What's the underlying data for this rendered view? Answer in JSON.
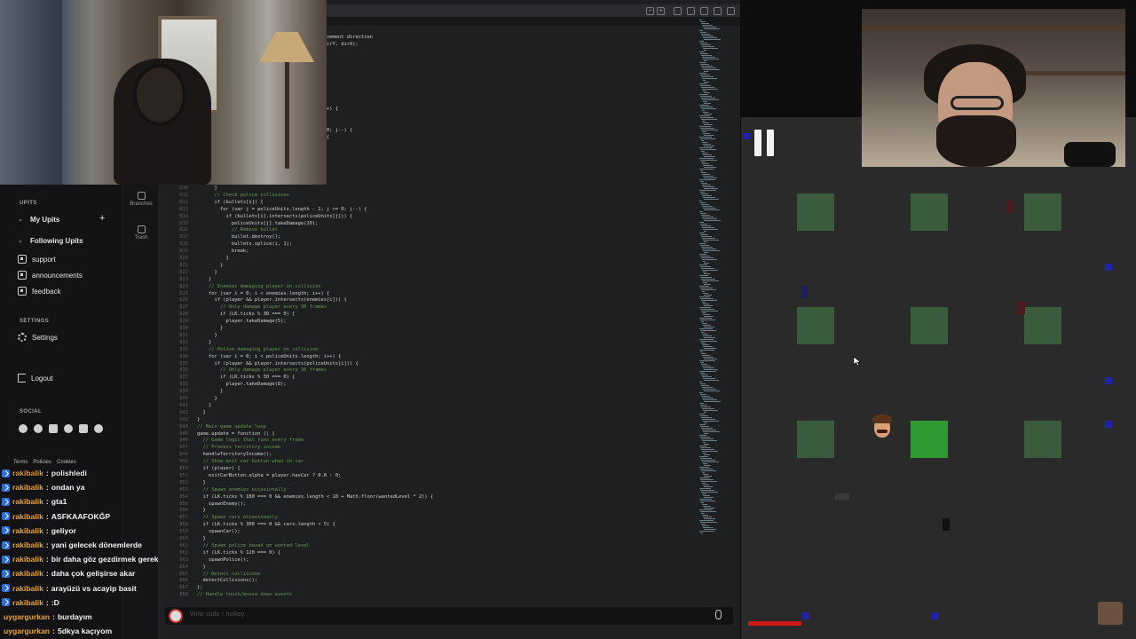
{
  "sidebar": {
    "upits_label": "UPITS",
    "my_upits": "My Upits",
    "following_upits": "Following Upits",
    "items": [
      {
        "label": "support",
        "icon": "box-icon"
      },
      {
        "label": "announcements",
        "icon": "box-icon"
      },
      {
        "label": "feedback",
        "icon": "box-icon"
      }
    ],
    "settings_section": "SETTINGS",
    "settings_label": "Settings",
    "logout_label": "Logout",
    "social_section": "SOCIAL",
    "social_icons": [
      "discord-icon",
      "reddit-icon",
      "x-icon",
      "bluesky-icon",
      "instagram-icon",
      "facebook-icon"
    ],
    "footer_links": [
      "Terms",
      "Policies",
      "Cookies"
    ]
  },
  "rail": {
    "branches_label": "Branches",
    "trash_label": "Trash"
  },
  "chat": {
    "messages": [
      {
        "user": "rakibalik",
        "text": "polishledi"
      },
      {
        "user": "rakibalik",
        "text": "ondan ya"
      },
      {
        "user": "rakibalik",
        "text": "gta1"
      },
      {
        "user": "rakibalik",
        "text": "ASFKAAFOKĞP"
      },
      {
        "user": "rakibalik",
        "text": "geliyor"
      },
      {
        "user": "rakibalik",
        "text": "yani gelecek dönemlerde"
      },
      {
        "user": "rakibalik",
        "text": "bir daha göz gezdirmek gerek"
      },
      {
        "user": "rakibalik",
        "text": "daha çok gelişirse akar"
      },
      {
        "user": "rakibalik",
        "text": "arayüzü vs acayip basit"
      },
      {
        "user": "rakibalik",
        "text": ":D"
      },
      {
        "user": "uygargurkan",
        "text": "burdayım"
      },
      {
        "user": "uygargurkan",
        "text": "5dkya kaçıyom"
      }
    ],
    "separator": ":",
    "user_color": "#e5a43a"
  },
  "editor": {
    "top_fragments": [
      "vement direction",
      "irY, dirX);",
      "+) {",
      "0; j--) {",
      "{"
    ],
    "lines": [
      {
        "n": "810",
        "t": "      }"
      },
      {
        "n": "811",
        "t": "      // Check police collisions"
      },
      {
        "n": "812",
        "t": "      if (bullets[i]) {"
      },
      {
        "n": "813",
        "t": "        for (var j = policeUnits.length - 1; j >= 0; j--) {"
      },
      {
        "n": "814",
        "t": "          if (bullets[i].intersects(policeUnits[j])) {"
      },
      {
        "n": "815",
        "t": "            policeUnits[j].takeDamage(20);"
      },
      {
        "n": "816",
        "t": "            // Remove bullet"
      },
      {
        "n": "817",
        "t": "            bullet.destroy();"
      },
      {
        "n": "818",
        "t": "            bullets.splice(i, 1);"
      },
      {
        "n": "819",
        "t": "            break;"
      },
      {
        "n": "820",
        "t": "          }"
      },
      {
        "n": "821",
        "t": "        }"
      },
      {
        "n": "822",
        "t": "      }"
      },
      {
        "n": "823",
        "t": "    }"
      },
      {
        "n": "824",
        "t": "    // Enemies damaging player on collision"
      },
      {
        "n": "825",
        "t": "    for (var i = 0; i < enemies.length; i++) {"
      },
      {
        "n": "826",
        "t": "      if (player && player.intersects(enemies[i])) {"
      },
      {
        "n": "827",
        "t": "        // Only damage player every 30 frames"
      },
      {
        "n": "828",
        "t": "        if (LK.ticks % 30 === 0) {"
      },
      {
        "n": "829",
        "t": "          player.takeDamage(5);"
      },
      {
        "n": "830",
        "t": "        }"
      },
      {
        "n": "831",
        "t": "      }"
      },
      {
        "n": "832",
        "t": "    }"
      },
      {
        "n": "833",
        "t": "    // Police damaging player on collision"
      },
      {
        "n": "834",
        "t": "    for (var i = 0; i < policeUnits.length; i++) {"
      },
      {
        "n": "835",
        "t": "      if (player && player.intersects(policeUnits[i])) {"
      },
      {
        "n": "836",
        "t": "        // Only damage player every 30 frames"
      },
      {
        "n": "837",
        "t": "        if (LK.ticks % 30 === 0) {"
      },
      {
        "n": "838",
        "t": "          player.takeDamage(8);"
      },
      {
        "n": "839",
        "t": "        }"
      },
      {
        "n": "840",
        "t": "      }"
      },
      {
        "n": "841",
        "t": "    }"
      },
      {
        "n": "842",
        "t": "  }"
      },
      {
        "n": "843",
        "t": "}"
      },
      {
        "n": "844",
        "t": "// Main game update loop"
      },
      {
        "n": "845",
        "t": "game.update = function () {"
      },
      {
        "n": "846",
        "t": "  // Game logic that runs every frame"
      },
      {
        "n": "847",
        "t": "  // Process territory income"
      },
      {
        "n": "848",
        "t": "  handleTerritoryIncome();"
      },
      {
        "n": "849",
        "t": "  // Show exit car button when in car"
      },
      {
        "n": "850",
        "t": "  if (player) {"
      },
      {
        "n": "851",
        "t": "    exitCarButton.alpha = player.hasCar ? 0.8 : 0;"
      },
      {
        "n": "852",
        "t": "  }"
      },
      {
        "n": "853",
        "t": "  // Spawn enemies occasionally"
      },
      {
        "n": "854",
        "t": "  if (LK.ticks % 180 === 0 && enemies.length < 10 + Math.floor(wantedLevel * 2)) {"
      },
      {
        "n": "855",
        "t": "    spawnEnemy();"
      },
      {
        "n": "856",
        "t": "  }"
      },
      {
        "n": "857",
        "t": "  // Spawn cars occasionally"
      },
      {
        "n": "858",
        "t": "  if (LK.ticks % 300 === 0 && cars.length < 5) {"
      },
      {
        "n": "859",
        "t": "    spawnCar();"
      },
      {
        "n": "860",
        "t": "  }"
      },
      {
        "n": "861",
        "t": "  // Spawn police based on wanted level"
      },
      {
        "n": "862",
        "t": "  if (LK.ticks % 120 === 0) {"
      },
      {
        "n": "863",
        "t": "    spawnPolice();"
      },
      {
        "n": "864",
        "t": "  }"
      },
      {
        "n": "865",
        "t": "  // Detect collisions"
      },
      {
        "n": "866",
        "t": "  detectCollisions();"
      },
      {
        "n": "867",
        "t": "};"
      },
      {
        "n": "868",
        "t": "// Handle touch/mouse down events"
      }
    ],
    "chat_placeholder": "Write code ↑ hotkey"
  },
  "game": {
    "health_fraction": 1.0
  }
}
